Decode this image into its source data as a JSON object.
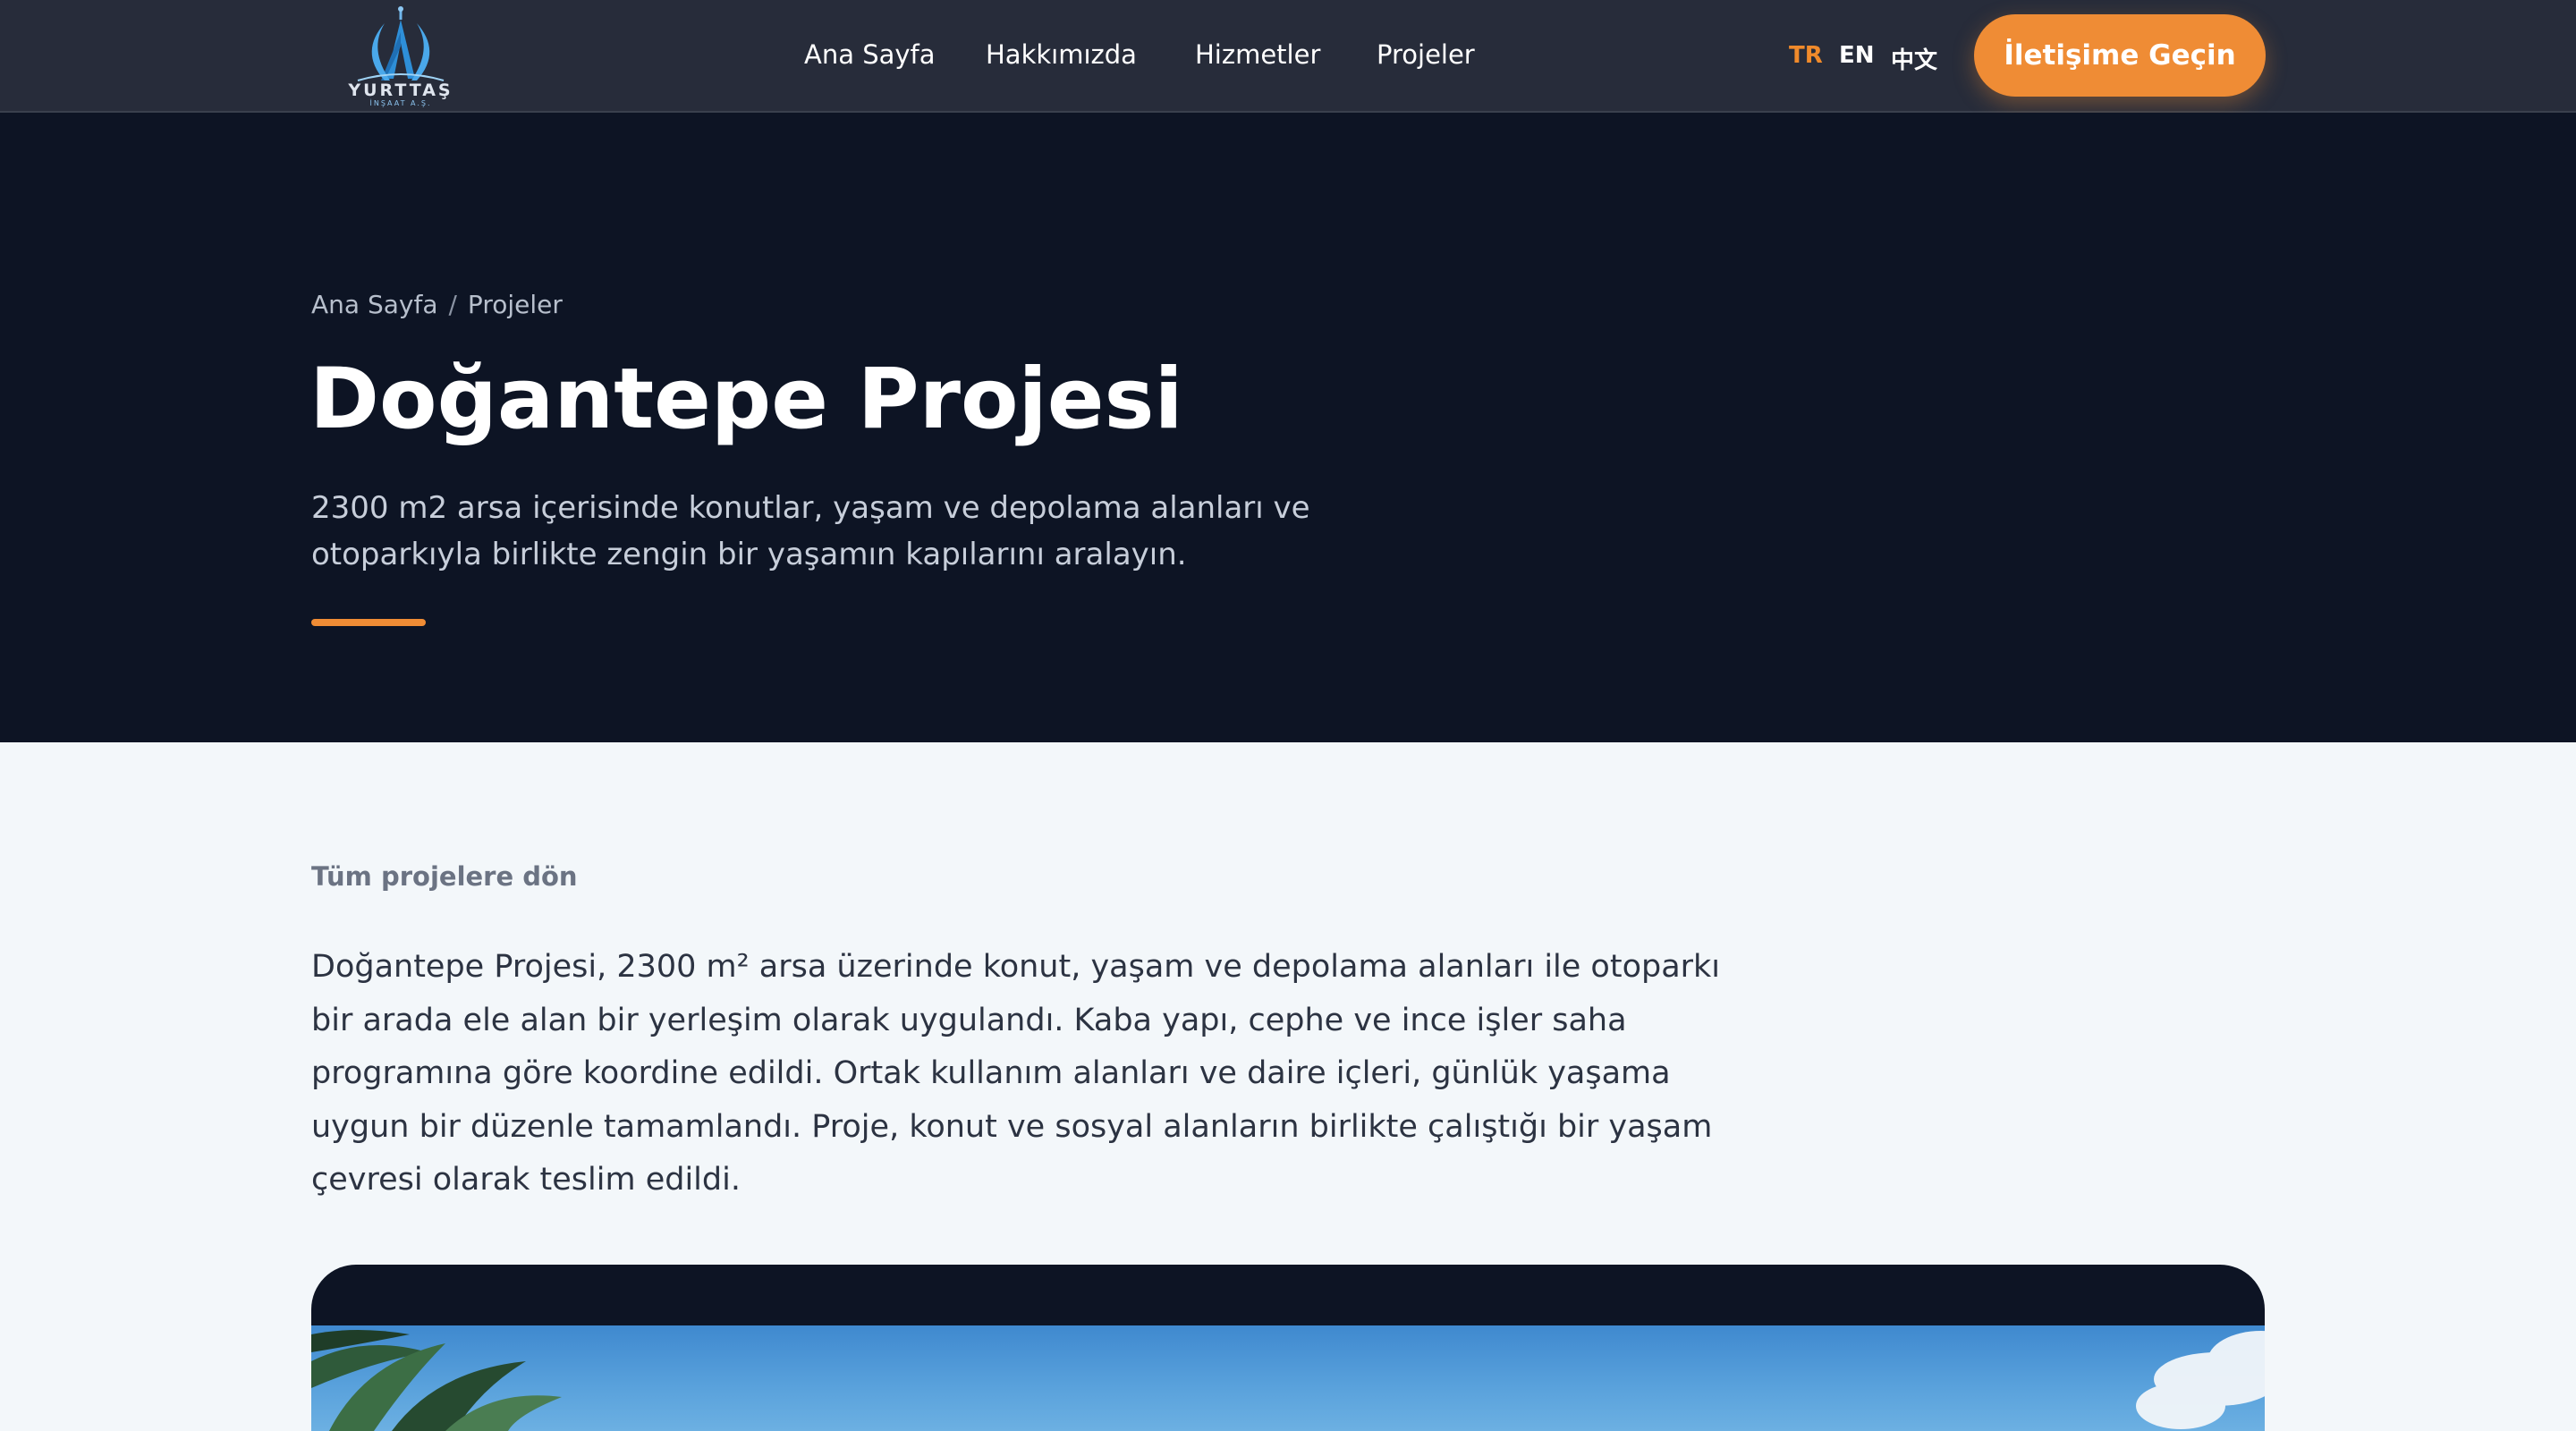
{
  "header": {
    "logo": {
      "name": "YURTTAŞ",
      "subtitle": "İNŞAAT A.Ş."
    },
    "nav": [
      {
        "label": "Ana Sayfa"
      },
      {
        "label": "Hakkımızda"
      },
      {
        "label": "Hizmetler"
      },
      {
        "label": "Projeler"
      }
    ],
    "languages": [
      {
        "code": "TR",
        "active": true
      },
      {
        "code": "EN",
        "active": false
      },
      {
        "code": "中文",
        "active": false
      }
    ],
    "cta_label": "İletişime Geçin"
  },
  "hero": {
    "breadcrumb": {
      "home": "Ana Sayfa",
      "separator": "/",
      "current": "Projeler"
    },
    "title": "Doğantepe Projesi",
    "subtitle": "2300 m2 arsa içerisinde konutlar, yaşam ve depolama alanları ve otoparkıyla birlikte zengin bir yaşamın kapılarını aralayın."
  },
  "content": {
    "back_link": "Tüm projelere dön",
    "description": "Doğantepe Projesi, 2300 m² arsa üzerinde konut, yaşam ve depolama alanları ile otoparkı bir arada ele alan bir yerleşim olarak uygulandı. Kaba yapı, cephe ve ince işler saha programına göre koordine edildi. Ortak kullanım alanları ve daire içleri, günlük yaşama uygun bir düzenle tamamlandı. Proje, konut ve sosyal alanların birlikte çalıştığı bir yaşam çevresi olarak teslim edildi."
  },
  "colors": {
    "header_bg": "#272c3a",
    "hero_bg": "#0d1424",
    "accent": "#ef8c35",
    "page_bg": "#f3f7fa",
    "body_text": "#2c3342"
  },
  "icons": {
    "logo": "tower-logo-icon"
  }
}
